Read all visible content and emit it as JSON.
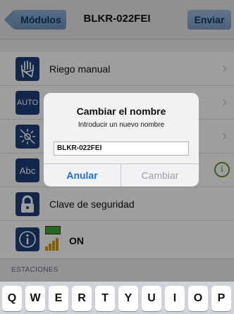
{
  "nav": {
    "back_label": "Módulos",
    "title": "BLKR-022FEI",
    "send_label": "Enviar"
  },
  "rows": [
    {
      "label": "Riego manual",
      "icon": "hand-icon"
    },
    {
      "label": "",
      "icon_text": "AUTO"
    },
    {
      "label": "",
      "icon": "broken-sun-icon"
    },
    {
      "label": "",
      "icon_text": "Abc"
    },
    {
      "label": "Clave de seguridad",
      "icon": "lock-icon"
    },
    {
      "label": "ON",
      "icon": "info-icon"
    }
  ],
  "section": {
    "header": "ESTACIONES"
  },
  "alert": {
    "title": "Cambiar el nombre",
    "message": "Introducir un nuevo nombre",
    "input_value": "BLKR-022FEI",
    "cancel_label": "Anular",
    "confirm_label": "Cambiar"
  },
  "keyboard": {
    "keys": [
      "Q",
      "W",
      "E",
      "R",
      "T",
      "Y",
      "U",
      "I",
      "O",
      "P"
    ]
  },
  "colors": {
    "accent": "#1a6fd1",
    "icon_bg": "#1e3f7a",
    "status_green": "#5a9a2a"
  }
}
